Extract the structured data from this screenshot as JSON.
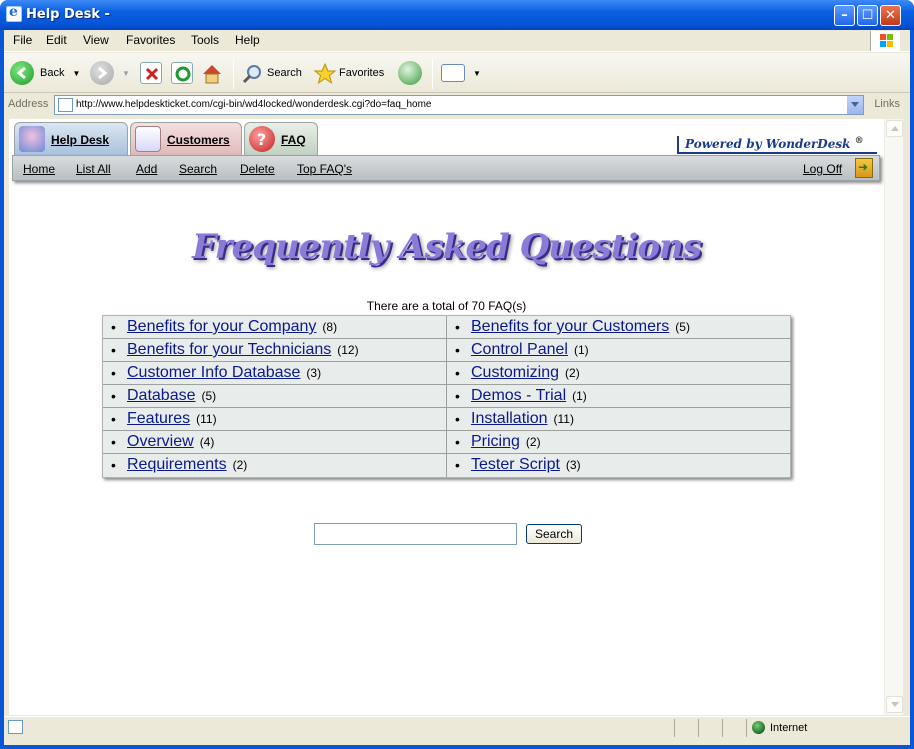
{
  "window": {
    "title": "Help Desk -"
  },
  "menubar": {
    "items": [
      "File",
      "Edit",
      "View",
      "Favorites",
      "Tools",
      "Help"
    ]
  },
  "toolbar": {
    "back_label": "Back",
    "search_label": "Search",
    "favorites_label": "Favorites"
  },
  "addressbar": {
    "label": "Address",
    "url": "http://www.helpdeskticket.com/cgi-bin/wd4locked/wonderdesk.cgi?do=faq_home",
    "links_label": "Links"
  },
  "tabs": [
    {
      "label": "Help Desk",
      "color": "#a8c8e8"
    },
    {
      "label": "Customers",
      "color": "#e8c8c8"
    },
    {
      "label": "FAQ",
      "color": "#c8d8c8"
    }
  ],
  "powered_by": {
    "text": "Powered by WonderDesk",
    "mark": "®"
  },
  "nav": {
    "links": [
      "Home",
      "List All",
      "Add",
      "Search",
      "Delete",
      "Top FAQ's"
    ],
    "logoff": "Log Off"
  },
  "page": {
    "heading": "Frequently Asked Questions",
    "count_text": "There are a total of 70 FAQ(s)"
  },
  "faq": {
    "categories": [
      {
        "name": "Benefits for your Company",
        "count": "(8)"
      },
      {
        "name": "Benefits for your Customers",
        "count": "(5)"
      },
      {
        "name": "Benefits for your Technicians",
        "count": "(12)"
      },
      {
        "name": "Control Panel",
        "count": "(1)"
      },
      {
        "name": "Customer Info Database",
        "count": "(3)"
      },
      {
        "name": "Customizing",
        "count": "(2)"
      },
      {
        "name": "Database",
        "count": "(5)"
      },
      {
        "name": "Demos - Trial",
        "count": "(1)"
      },
      {
        "name": "Features",
        "count": "(11)"
      },
      {
        "name": "Installation",
        "count": "(11)"
      },
      {
        "name": "Overview",
        "count": "(4)"
      },
      {
        "name": "Pricing",
        "count": "(2)"
      },
      {
        "name": "Requirements",
        "count": "(2)"
      },
      {
        "name": "Tester Script",
        "count": "(3)"
      }
    ]
  },
  "search": {
    "button_label": "Search",
    "value": ""
  },
  "statusbar": {
    "zone": "Internet"
  }
}
